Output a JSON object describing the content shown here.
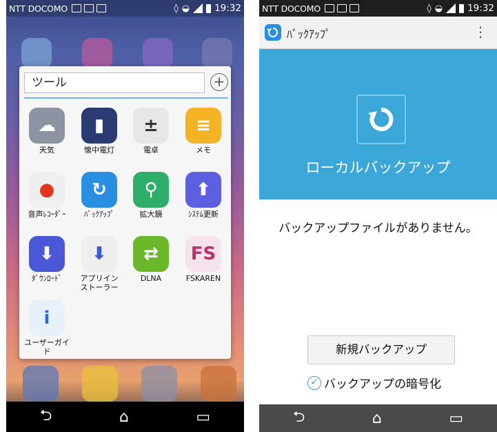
{
  "left_screen": {
    "status": {
      "carrier": "NTT DOCOMO",
      "time": "19:32"
    },
    "folder": {
      "title": "ツール",
      "apps": [
        {
          "label": "天気",
          "icon": "weather-icon",
          "color": "#8d93a3"
        },
        {
          "label": "懐中電灯",
          "icon": "flashlight-icon",
          "color": "#2a3a73"
        },
        {
          "label": "電卓",
          "icon": "calculator-icon",
          "color": "#e7e7e7"
        },
        {
          "label": "メモ",
          "icon": "memo-icon",
          "color": "#f4b225"
        },
        {
          "label": "音声ﾚｺｰﾀﾞｰ",
          "icon": "voice-recorder-icon",
          "color": "#efefef"
        },
        {
          "label": "ﾊﾞｯｸｱｯﾌﾟ",
          "icon": "backup-icon",
          "color": "#2a8fe0"
        },
        {
          "label": "拡大鏡",
          "icon": "magnifier-icon",
          "color": "#2fae6a"
        },
        {
          "label": "ｼｽﾃﾑ更新",
          "icon": "system-update-icon",
          "color": "#5b5fe0"
        },
        {
          "label": "ﾀﾞｳﾝﾛｰﾄﾞ",
          "icon": "download-icon",
          "color": "#4a58d8"
        },
        {
          "label": "アプリイン\nストーラー",
          "icon": "app-installer-icon",
          "color": "#eeeeee"
        },
        {
          "label": "DLNA",
          "icon": "dlna-icon",
          "color": "#6ab82a"
        },
        {
          "label": "FSKAREN",
          "icon": "fskaren-icon",
          "color": "#f7e3ee"
        },
        {
          "label": "ユーザーガイ\nド",
          "icon": "user-guide-icon",
          "color": "#e8f0fa"
        }
      ]
    },
    "nav": {
      "back": "⮌",
      "home": "⌂",
      "recents": "▭"
    }
  },
  "right_screen": {
    "status": {
      "carrier": "NTT DOCOMO",
      "time": "19:32"
    },
    "appbar": {
      "title": "ﾊﾞｯｸｱｯﾌﾟ",
      "menu": "⋮"
    },
    "hero": {
      "title": "ローカルバックアップ",
      "color": "#3aa7d8"
    },
    "empty_message": "バックアップファイルがありません。",
    "new_backup_button": "新規バックアップ",
    "encrypt_option": {
      "label": "バックアップの暗号化",
      "checked": true
    },
    "nav": {
      "back": "⮌",
      "home": "⌂",
      "recents": "▭"
    }
  }
}
